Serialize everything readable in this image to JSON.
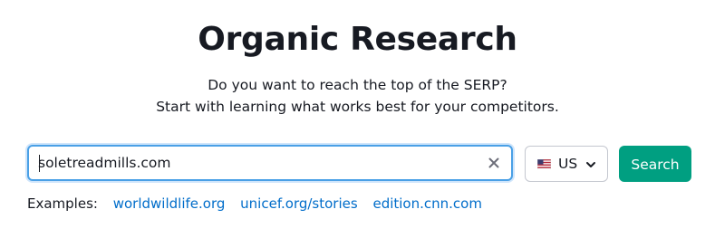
{
  "page": {
    "title": "Organic Research",
    "subtitle_line1": "Do you want to reach the top of the SERP?",
    "subtitle_line2": "Start with learning what works best for your competitors."
  },
  "search": {
    "value": "soletreadmills.com",
    "clear_icon": "close-icon",
    "button_label": "Search"
  },
  "country": {
    "selected": "US",
    "flag_icon": "us-flag-icon",
    "chevron_icon": "chevron-down-icon"
  },
  "examples": {
    "label": "Examples:",
    "links": [
      "worldwildlife.org",
      "unicef.org/stories",
      "edition.cnn.com"
    ]
  },
  "colors": {
    "accent": "#009f81",
    "link": "#006dca",
    "focus_border": "#4aa0e6"
  }
}
